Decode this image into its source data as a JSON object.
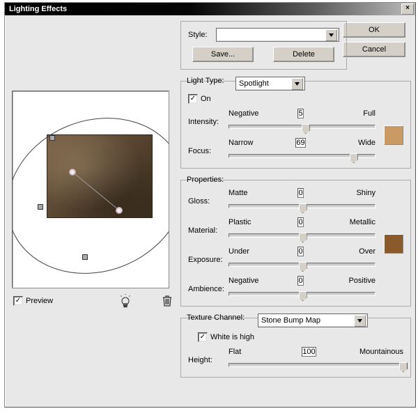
{
  "title": "Lighting Effects",
  "buttons": {
    "ok": "OK",
    "cancel": "Cancel",
    "save": "Save...",
    "delete": "Delete",
    "close": "×"
  },
  "style_section": {
    "label": "Style:",
    "value": ""
  },
  "preview": {
    "checkbox_label": "Preview",
    "checked": true
  },
  "light_type": {
    "legend": "Light Type:",
    "value": "Spotlight",
    "on_label": "On",
    "on_checked": true,
    "intensity": {
      "label": "Intensity:",
      "left": "Negative",
      "right": "Full",
      "value": 5,
      "pos": 52
    },
    "focus": {
      "label": "Focus:",
      "left": "Narrow",
      "right": "Wide",
      "value": 69,
      "pos": 85
    },
    "swatch": "#c99a63"
  },
  "properties": {
    "legend": "Properties:",
    "gloss": {
      "label": "Gloss:",
      "left": "Matte",
      "right": "Shiny",
      "value": 0,
      "pos": 50
    },
    "material": {
      "label": "Material:",
      "left": "Plastic",
      "right": "Metallic",
      "value": 0,
      "pos": 50
    },
    "exposure": {
      "label": "Exposure:",
      "left": "Under",
      "right": "Over",
      "value": 0,
      "pos": 50
    },
    "ambience": {
      "label": "Ambience:",
      "left": "Negative",
      "right": "Positive",
      "value": 0,
      "pos": 50
    },
    "swatch": "#8a5a2d"
  },
  "texture": {
    "legend": "Texture Channel:",
    "value": "Stone Bump Map",
    "white_label": "White is high",
    "white_checked": true,
    "height": {
      "label": "Height:",
      "left": "Flat",
      "right": "Mountainous",
      "value": 100,
      "pos": 100
    }
  },
  "icons": {
    "check": "✓"
  }
}
